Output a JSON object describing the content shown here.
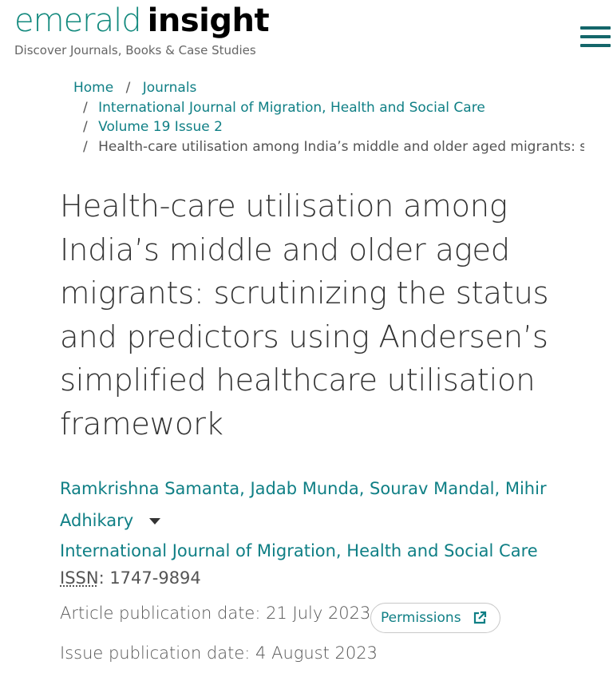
{
  "brand": {
    "name_part1": "emerald",
    "name_part2": "insight",
    "tagline": "Discover Journals, Books & Case Studies"
  },
  "header": {
    "menu_icon": "hamburger-menu-icon"
  },
  "breadcrumb": {
    "items": [
      "Home",
      "Journals",
      "International Journal of Migration, Health and Social Care",
      "Volume 19 Issue 2",
      "Health-care utilisation among India’s middle and older aged migrants: scr"
    ],
    "separator": "/"
  },
  "article": {
    "title": "Health-care utilisation among India’s middle and older aged migrants: scrutinizing the status and predictors using Andersen’s simplified healthcare utilisation framework",
    "authors": [
      "Ramkrishna Samanta",
      "Jadab Munda",
      "Sourav Mandal",
      "Mihir Adhikary"
    ],
    "author_separator": ", ",
    "journal": "International Journal of Migration, Health and Social Care",
    "issn_label": "ISSN",
    "issn_value": ": 1747-9894",
    "article_pub_date": "Article publication date: 21 July 2023",
    "issue_pub_date": "Issue publication date: 4 August 2023",
    "permissions_label": "Permissions",
    "permissions_icon": "external-link-icon"
  },
  "colors": {
    "accent": "#0f7f85",
    "brand_green": "#12897d",
    "text": "#333333"
  }
}
